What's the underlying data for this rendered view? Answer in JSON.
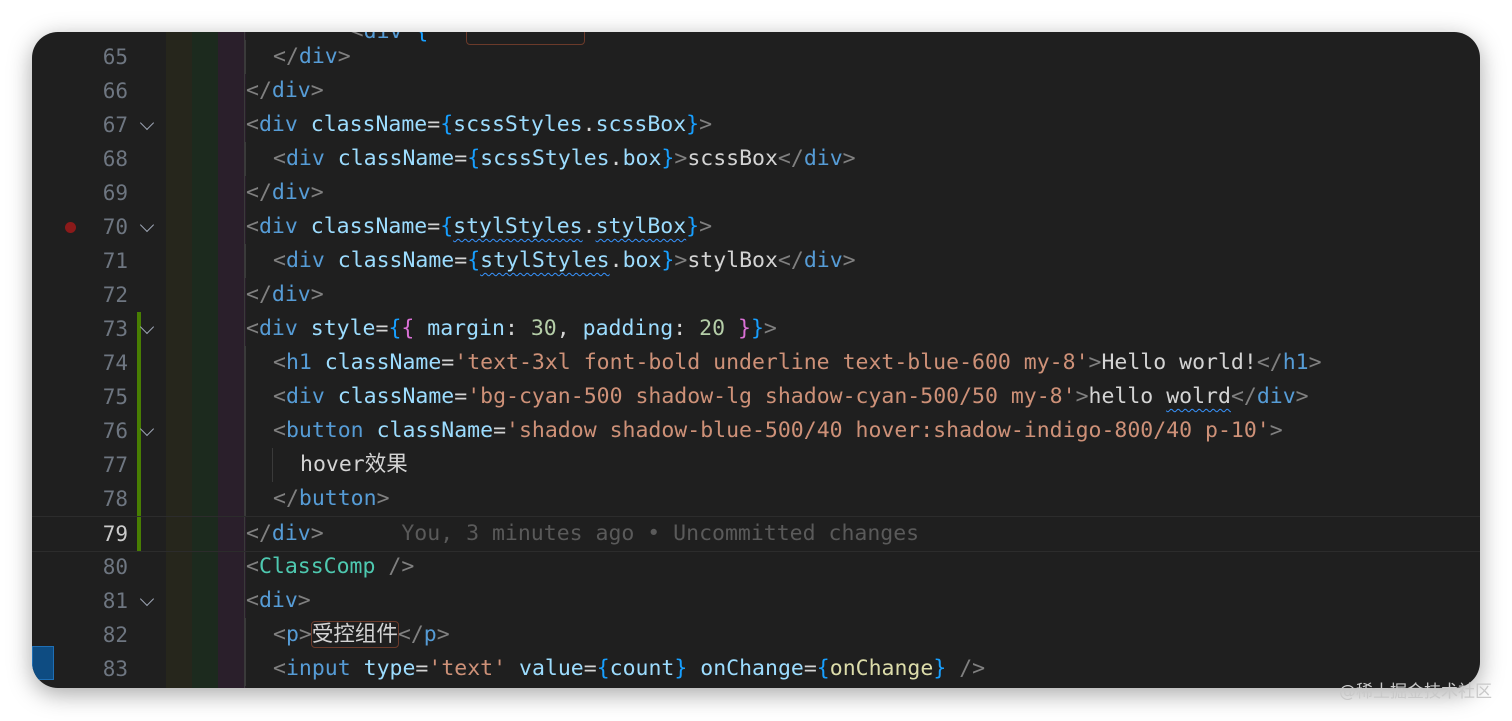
{
  "editor": {
    "blame": "You, 3 minutes ago • Uncommitted changes",
    "lines": [
      {
        "n": "65",
        "indent": 1,
        "html": "<span class='pun'>&lt;/</span><span class='tag'>div</span><span class='pun'>&gt;</span>"
      },
      {
        "n": "66",
        "indent": 0,
        "html": "<span class='pun'>&lt;/</span><span class='tag'>div</span><span class='pun'>&gt;</span>"
      },
      {
        "n": "67",
        "indent": 0,
        "fold": true,
        "html": "<span class='pun'>&lt;</span><span class='tag'>div</span> <span class='attr'>className</span><span class='txt'>=</span><span class='brace'>{</span><span class='var'>scssStyles</span><span class='txt'>.</span><span class='var'>scssBox</span><span class='brace'>}</span><span class='pun'>&gt;</span>"
      },
      {
        "n": "68",
        "indent": 1,
        "html": "<span class='pun'>&lt;</span><span class='tag'>div</span> <span class='attr'>className</span><span class='txt'>=</span><span class='brace'>{</span><span class='var'>scssStyles</span><span class='txt'>.</span><span class='var'>box</span><span class='brace'>}</span><span class='pun'>&gt;</span><span class='txt'>scssBox</span><span class='pun'>&lt;/</span><span class='tag'>div</span><span class='pun'>&gt;</span>"
      },
      {
        "n": "69",
        "indent": 0,
        "html": "<span class='pun'>&lt;/</span><span class='tag'>div</span><span class='pun'>&gt;</span>"
      },
      {
        "n": "70",
        "indent": 0,
        "fold": true,
        "bp": true,
        "html": "<span class='pun'>&lt;</span><span class='tag'>div</span> <span class='attr'>className</span><span class='txt'>=</span><span class='brace'>{</span><span class='var squig'>stylStyles</span><span class='txt'>.</span><span class='var squig'>stylBox</span><span class='brace'>}</span><span class='pun'>&gt;</span>"
      },
      {
        "n": "71",
        "indent": 1,
        "html": "<span class='pun'>&lt;</span><span class='tag'>div</span> <span class='attr'>className</span><span class='txt'>=</span><span class='brace'>{</span><span class='var squig'>stylStyles</span><span class='txt'>.</span><span class='var'>box</span><span class='brace'>}</span><span class='pun'>&gt;</span><span class='txt'>stylBox</span><span class='pun'>&lt;/</span><span class='tag'>div</span><span class='pun'>&gt;</span>"
      },
      {
        "n": "72",
        "indent": 0,
        "html": "<span class='pun'>&lt;/</span><span class='tag'>div</span><span class='pun'>&gt;</span>"
      },
      {
        "n": "73",
        "indent": 0,
        "fold": true,
        "mod": true,
        "html": "<span class='pun'>&lt;</span><span class='tag'>div</span> <span class='attr'>style</span><span class='txt'>=</span><span class='brace'>{</span><span class='brace2'>{</span> <span class='attr'>margin</span><span class='txt'>: </span><span class='num'>30</span><span class='txt'>, </span><span class='attr'>padding</span><span class='txt'>: </span><span class='num'>20</span> <span class='brace2'>}</span><span class='brace'>}</span><span class='pun'>&gt;</span>"
      },
      {
        "n": "74",
        "indent": 1,
        "mod": true,
        "html": "<span class='pun'>&lt;</span><span class='tag'>h1</span> <span class='attr'>className</span><span class='txt'>=</span><span class='str'>'text-3xl font-bold underline text-blue-600 my-8'</span><span class='pun'>&gt;</span><span class='txt'>Hello world!</span><span class='pun'>&lt;/</span><span class='tag'>h1</span><span class='pun'>&gt;</span>"
      },
      {
        "n": "75",
        "indent": 1,
        "mod": true,
        "html": "<span class='pun'>&lt;</span><span class='tag'>div</span> <span class='attr'>className</span><span class='txt'>=</span><span class='str'>'bg-cyan-500 shadow-lg shadow-cyan-500/50 my-8'</span><span class='pun'>&gt;</span><span class='txt'>hello </span><span class='txt squig'>wolrd</span><span class='pun'>&lt;/</span><span class='tag'>div</span><span class='pun'>&gt;</span>"
      },
      {
        "n": "76",
        "indent": 1,
        "fold": true,
        "mod": true,
        "html": "<span class='pun'>&lt;</span><span class='tag'>button</span> <span class='attr'>className</span><span class='txt'>=</span><span class='str'>'shadow shadow-blue-500/40 hover:shadow-indigo-800/40 p-10'</span><span class='pun'>&gt;</span>"
      },
      {
        "n": "77",
        "indent": 2,
        "mod": true,
        "html": "<span class='txt'>hover效果</span>"
      },
      {
        "n": "78",
        "indent": 1,
        "mod": true,
        "html": "<span class='pun'>&lt;/</span><span class='tag'>button</span><span class='pun'>&gt;</span>"
      },
      {
        "n": "79",
        "indent": 0,
        "mod": true,
        "current": true,
        "html": "<span class='pun'>&lt;/</span><span class='tag'>div</span><span class='pun'>&gt;</span>      <span class='blame' data-bind='editor.blame'></span>"
      },
      {
        "n": "80",
        "indent": 0,
        "html": "<span class='pun'>&lt;</span><span class='comp'>ClassComp</span> <span class='pun'>/&gt;</span>"
      },
      {
        "n": "81",
        "indent": 0,
        "fold": true,
        "html": "<span class='pun'>&lt;</span><span class='tag'>div</span><span class='pun'>&gt;</span>"
      },
      {
        "n": "82",
        "indent": 1,
        "html": "<span class='pun'>&lt;</span><span class='tag'>p</span><span class='pun'>&gt;</span><span class='txt boxed'>受控组件</span><span class='pun'>&lt;/</span><span class='tag'>p</span><span class='pun'>&gt;</span>"
      },
      {
        "n": "83",
        "indent": 1,
        "html": "<span class='pun'>&lt;</span><span class='tag'>input</span> <span class='attr'>type</span><span class='txt'>=</span><span class='str'>'text'</span> <span class='attr'>value</span><span class='txt'>=</span><span class='brace'>{</span><span class='var'>count</span><span class='brace'>}</span> <span class='attr'>onChange</span><span class='txt'>=</span><span class='brace'>{</span><span class='fn'>onChange</span><span class='brace'>}</span> <span class='pun'>/&gt;</span>"
      }
    ]
  },
  "watermark": "@稀土掘金技术社区"
}
